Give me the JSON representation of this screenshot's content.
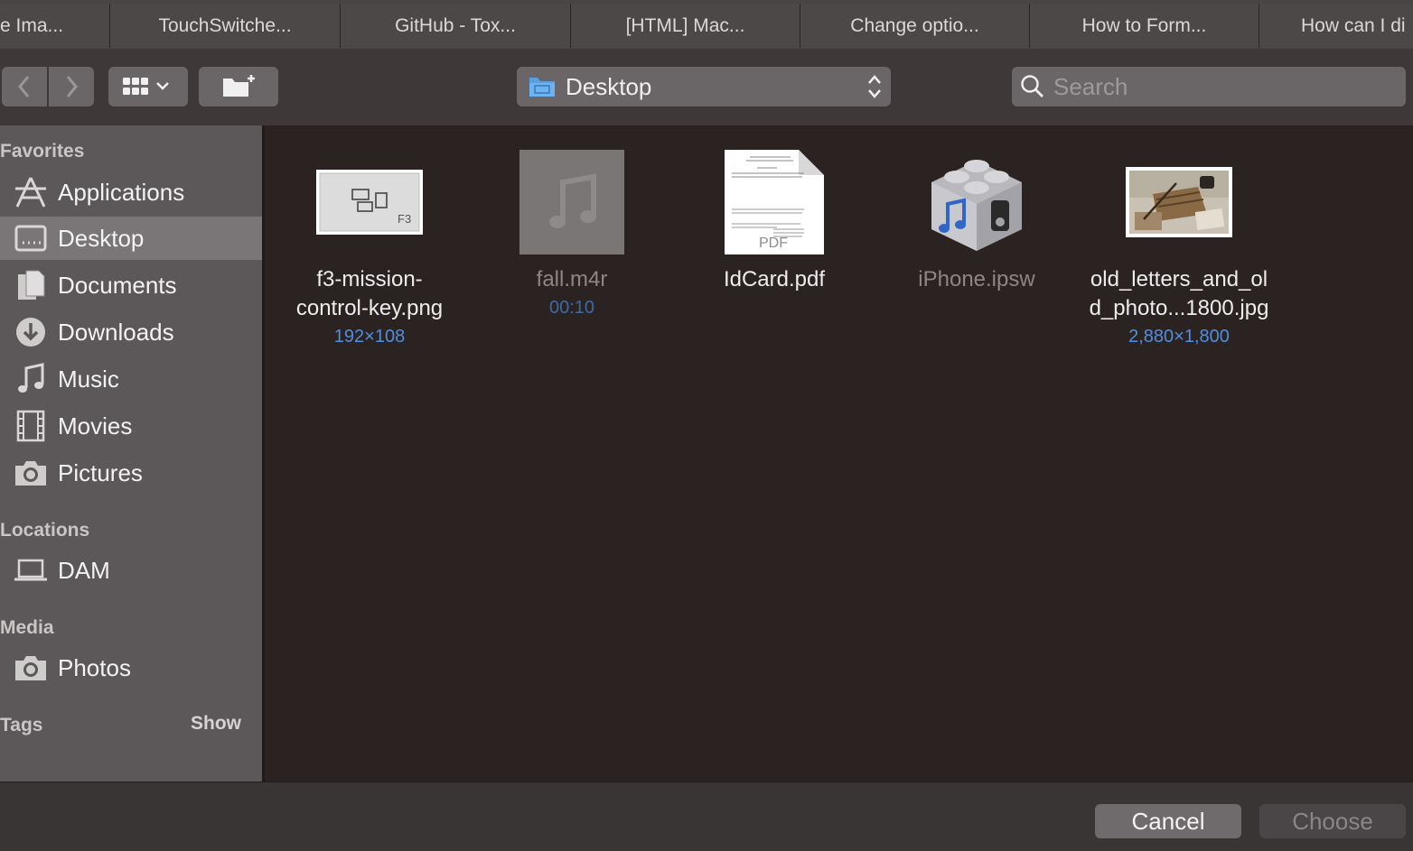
{
  "tabs": [
    "e Ima...",
    "TouchSwitche...",
    "GitHub - Tox...",
    "[HTML] Mac...",
    "Change optio...",
    "How to Form...",
    "How can I di"
  ],
  "toolbar": {
    "location": "Desktop",
    "search_placeholder": "Search"
  },
  "sidebar": {
    "favorites_heading": "Favorites",
    "favorites": [
      {
        "label": "Applications",
        "icon": "applications-icon"
      },
      {
        "label": "Desktop",
        "icon": "desktop-icon",
        "selected": true
      },
      {
        "label": "Documents",
        "icon": "documents-icon"
      },
      {
        "label": "Downloads",
        "icon": "downloads-icon"
      },
      {
        "label": "Music",
        "icon": "music-icon"
      },
      {
        "label": "Movies",
        "icon": "movies-icon"
      },
      {
        "label": "Pictures",
        "icon": "pictures-icon"
      }
    ],
    "locations_heading": "Locations",
    "locations": [
      {
        "label": "DAM",
        "icon": "laptop-icon"
      }
    ],
    "media_heading": "Media",
    "media": [
      {
        "label": "Photos",
        "icon": "camera-icon"
      }
    ],
    "tags_heading": "Tags",
    "tags_show": "Show"
  },
  "files": [
    {
      "name_line1": "f3-mission-",
      "name_line2": "control-key.png",
      "meta": "192×108",
      "dim": false
    },
    {
      "name_line1": "fall.m4r",
      "name_line2": "",
      "meta": "00:10",
      "dim": true
    },
    {
      "name_line1": "IdCard.pdf",
      "name_line2": "",
      "meta": "",
      "dim": false
    },
    {
      "name_line1": "iPhone.ipsw",
      "name_line2": "",
      "meta": "",
      "dim": true
    },
    {
      "name_line1": "old_letters_and_ol",
      "name_line2": "d_photo...1800.jpg",
      "meta": "2,880×1,800",
      "dim": false
    }
  ],
  "thumbs": {
    "f3_label": "F3",
    "pdf_label": "PDF"
  },
  "buttons": {
    "cancel": "Cancel",
    "choose": "Choose"
  }
}
